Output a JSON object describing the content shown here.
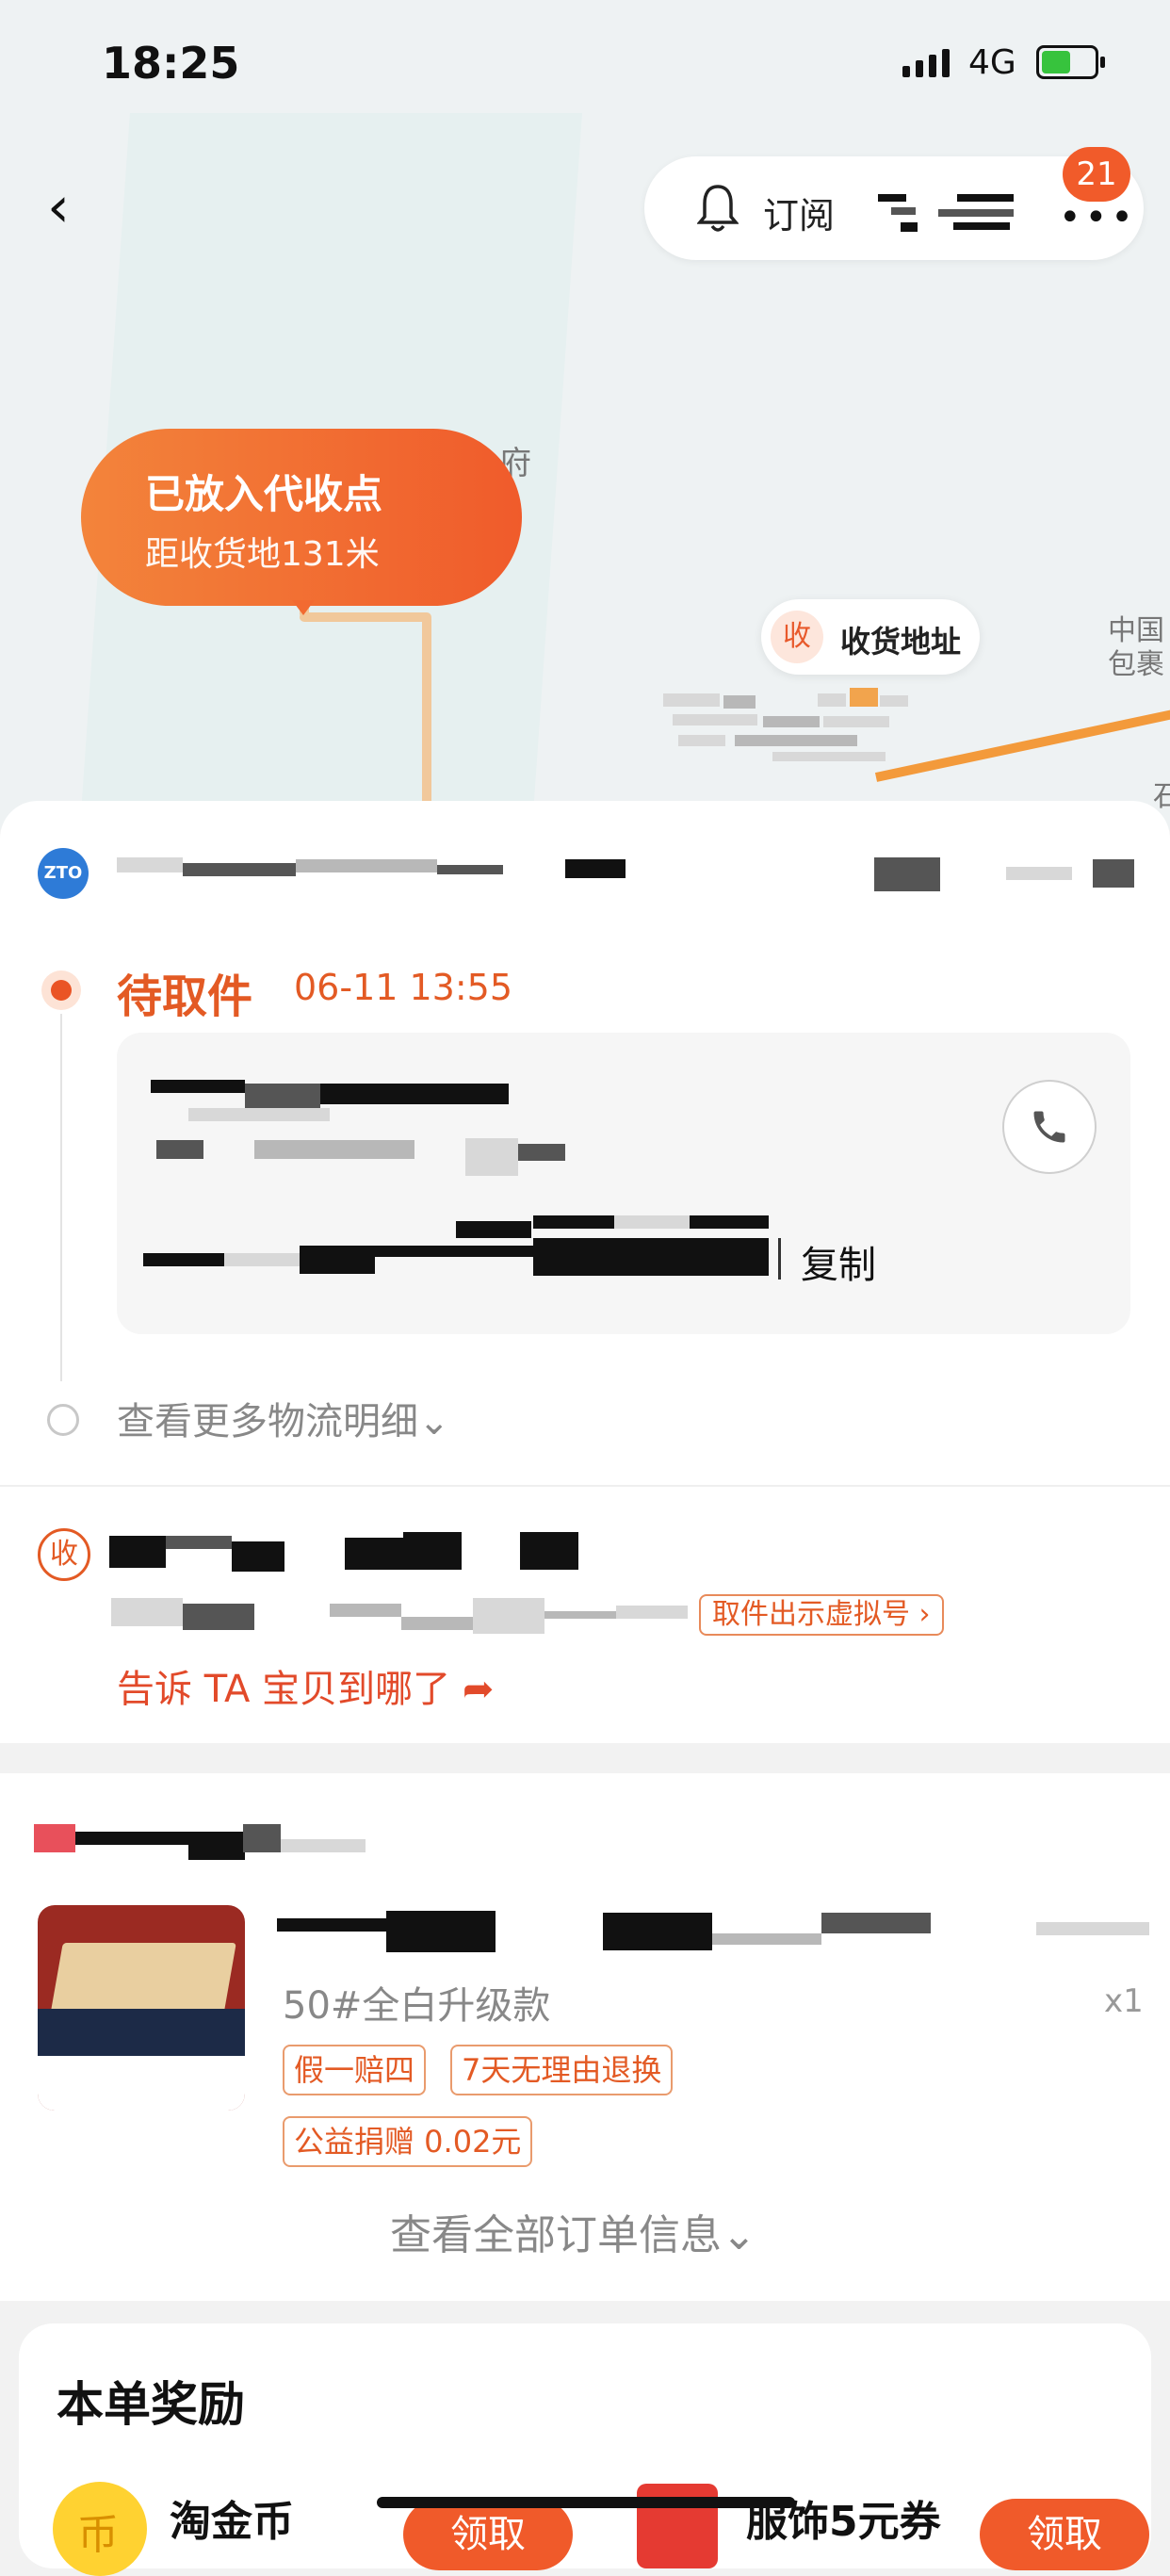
{
  "status_bar": {
    "time": "18:25",
    "network": "4G"
  },
  "nav": {
    "back": "‹",
    "subscribe": "订阅",
    "more": "•••",
    "badge": "21"
  },
  "map": {
    "label_fu": "府",
    "label_china": "中国",
    "label_bao": "包裹",
    "label_shi": "石",
    "bubble_title": "已放入代收点",
    "bubble_sub": "距收货地131米",
    "recv_pin_icon": "收",
    "recv_pin_label": "收货地址"
  },
  "logistics": {
    "carrier_logo_text": "ZTO",
    "status": "待取件",
    "status_time": "06-11 13:55",
    "copy": "复制",
    "more": "查看更多物流明细⌄"
  },
  "receiver": {
    "icon": "收",
    "virtual_number": "取件出示虚拟号 ›",
    "tell": "告诉 TA 宝贝到哪了 ➦"
  },
  "order": {
    "sku": "50#全白升级款",
    "qty": "x1",
    "tags": [
      "假一赔四",
      "7天无理由退换",
      "公益捐赠 0.02元"
    ],
    "view_all": "查看全部订单信息⌄"
  },
  "rewards": {
    "title": "本单奖励",
    "coin_icon": "币",
    "coin_label": "淘金币",
    "coin_button": "领取",
    "coupon_label": "服饰5元券",
    "coupon_button": "领取"
  },
  "colors": {
    "accent": "#e35a24",
    "bubble": "#f05b2b",
    "route": "#f1c89b"
  }
}
